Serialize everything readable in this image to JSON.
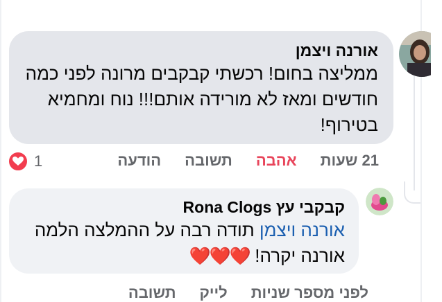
{
  "comment": {
    "author": "אורנה ויצמן",
    "text": "ממליצה בחום! רכשתי קבקבים מרונה לפני כמה חודשים ומאז לא מורידה אותם!!! נוח ומחמיא בטירוף!",
    "time": "21 שעות",
    "love_label": "אהבה",
    "reply_label": "תשובה",
    "message_label": "הודעה",
    "reaction_count": "1",
    "reaction_icon": "heart-icon"
  },
  "reply": {
    "author": "קבקבי עץ Rona Clogs",
    "mention": "אורנה ויצמן",
    "text": "תודה רבה על ההמלצה הלמה אורנה יקרה!",
    "hearts": "❤️❤️❤️",
    "time": "לפני מספר שניות",
    "like_label": "לייק",
    "reply_label": "תשובה"
  },
  "colors": {
    "bubble_primary": "#e4e6eb",
    "bubble_secondary": "#f0f2f5",
    "love_active": "#e8445a",
    "mention": "#1b5fb0",
    "meta": "#65676b"
  }
}
